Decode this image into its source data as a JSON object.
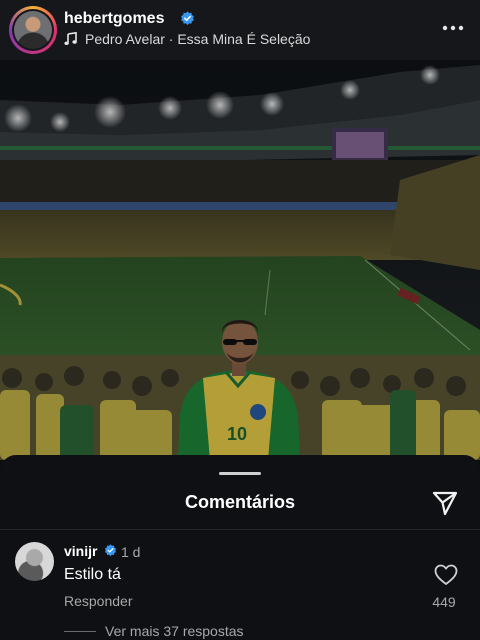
{
  "post": {
    "username": "hebertgomes",
    "verified": true,
    "music": "Pedro Avelar · Essa Mina É Seleção",
    "icons": {
      "verified": "verified-badge-icon",
      "music": "music-note-icon",
      "more": "more-options-icon"
    }
  },
  "photo": {
    "jersey_number": "10"
  },
  "comments_sheet": {
    "title": "Comentários",
    "share_icon": "share-send-icon",
    "comment": {
      "username": "vinijr",
      "verified": true,
      "time": "1 d",
      "text": "Estilo tá",
      "reply_label": "Responder",
      "likes": "449",
      "like_icon": "heart-icon",
      "view_more": "Ver mais 37 respostas"
    }
  },
  "colors": {
    "background": "#0e1013",
    "header": "#15171a",
    "verified": "#3897f0",
    "secondary_text": "#a8a8a8",
    "jersey_yellow": "#f1d34b",
    "jacket_green": "#1f8a3c"
  }
}
